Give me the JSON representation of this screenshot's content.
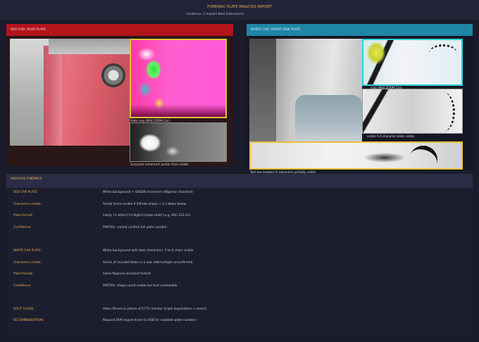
{
  "header": {
    "title": "FORENSIC PLATE ANALYSIS REPORT",
    "subtitle": "Evidence: 2 tripwid Bold Extractions"
  },
  "red_panel": {
    "title": "RED CAR: REAR PLATE",
    "caption_zoom": "Plate crop (MAX ZOOM 12x)",
    "caption_gray": "Grayscale enhanced: partial chars visible"
  },
  "white_panel": {
    "title": "WHITE CAR: FRONT SIDE PLATE",
    "caption_zoom": "crop (MAX ZOOM 12x)",
    "caption_blobs": "visible 5-6 character blobs visible",
    "caption_text": "Text row isolated: 6 characters partially visible"
  },
  "findings": {
    "title": "ANALYSIS FINDINGS",
    "rows": [
      {
        "label": "RED CAR PLATE:",
        "value": "White background + GREEN characters (Nigerian standard)"
      },
      {
        "label": "Characters visible:",
        "value": "Partial forms visible 8.5/8-like shape + 2-3 blobs below"
      },
      {
        "label": "Plate format:",
        "value": "Likely: [3 letters]-[3 digits]-[state code] (e.g. ABC-123-LG)"
      },
      {
        "label": "Confidence:",
        "value": "PARTIAL: cannot confirm full plate number"
      },
      {
        "label": "WHITE CAR PLATE:",
        "value": "White background with dark characters: 5 to 6 chars visible"
      },
      {
        "label": "Characters visible:",
        "value": "Series of rounded blobs in a row: letters/digits unconfirmed"
      },
      {
        "label": "Plate format:",
        "value": "Same Nigerian standard format"
      },
      {
        "label": "Confidence:",
        "value": "PARTIAL: shape count visible but text unreadable"
      },
      {
        "label": "ROOT CAUSE:",
        "value": "Video filmed on phone of CCTV monitor (triple degradation + moiré)"
      },
      {
        "label": "RECOMMENDATION:",
        "value": "Request DVR export direct to USB for readable plate numbers"
      }
    ]
  },
  "colors": {
    "accent": "#e8b64c",
    "red_header": "#b3141b",
    "blue_header": "#1f86a6",
    "zoom_border": "#e8c23a"
  }
}
